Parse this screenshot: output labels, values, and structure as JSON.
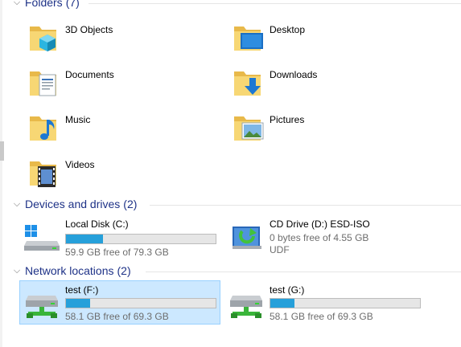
{
  "groups": {
    "folders": {
      "title": "Folders",
      "count": "(7)"
    },
    "devices": {
      "title": "Devices and drives",
      "count": "(2)"
    },
    "network": {
      "title": "Network locations",
      "count": "(2)"
    }
  },
  "folders": [
    {
      "label": "3D Objects",
      "icon": "3d-objects-folder-icon"
    },
    {
      "label": "Desktop",
      "icon": "desktop-folder-icon"
    },
    {
      "label": "Documents",
      "icon": "documents-folder-icon"
    },
    {
      "label": "Downloads",
      "icon": "downloads-folder-icon"
    },
    {
      "label": "Music",
      "icon": "music-folder-icon"
    },
    {
      "label": "Pictures",
      "icon": "pictures-folder-icon"
    },
    {
      "label": "Videos",
      "icon": "videos-folder-icon"
    }
  ],
  "drives": [
    {
      "name": "Local Disk (C:)",
      "free": "59.9 GB free of 79.3 GB",
      "used_fraction": 0.245,
      "icon": "windows-drive-icon"
    },
    {
      "name": "CD Drive (D:) ESD-ISO",
      "free": "0 bytes free of 4.55 GB",
      "fs": "UDF",
      "icon": "cd-drive-icon"
    }
  ],
  "network": [
    {
      "name": "test (F:)",
      "free": "58.1 GB free of 69.3 GB",
      "used_fraction": 0.16,
      "selected": true,
      "icon": "network-drive-icon"
    },
    {
      "name": "test (G:)",
      "free": "58.1 GB free of 69.3 GB",
      "used_fraction": 0.16,
      "selected": false,
      "icon": "network-drive-icon"
    }
  ],
  "colors": {
    "accent": "#26a0da",
    "group_header": "#1e3287",
    "selection": "#cce8ff"
  }
}
